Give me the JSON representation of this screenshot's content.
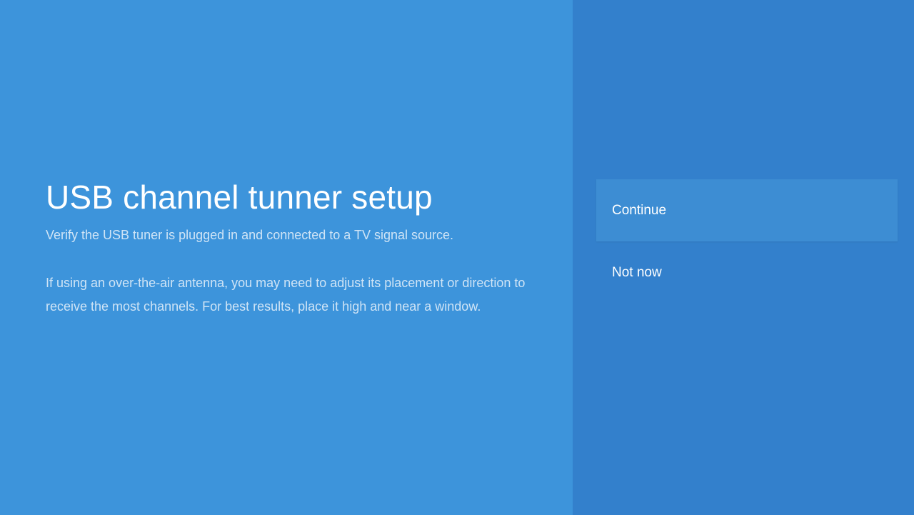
{
  "guidance": {
    "title": "USB channel tunner setup",
    "subtitle": "Verify the USB tuner is plugged in and connected to a TV signal source.",
    "description": "If using an over-the-air antenna, you may need to adjust its placement or direction to receive the most channels. For best results, place it high and near a window."
  },
  "actions": {
    "continue_label": "Continue",
    "not_now_label": "Not now"
  },
  "colors": {
    "guidance_background": "#3d94db",
    "actions_background": "#3380cc",
    "focused_action_background": "#3d8dd3",
    "primary_text": "#ffffff",
    "secondary_text": "#cfe4f6"
  }
}
